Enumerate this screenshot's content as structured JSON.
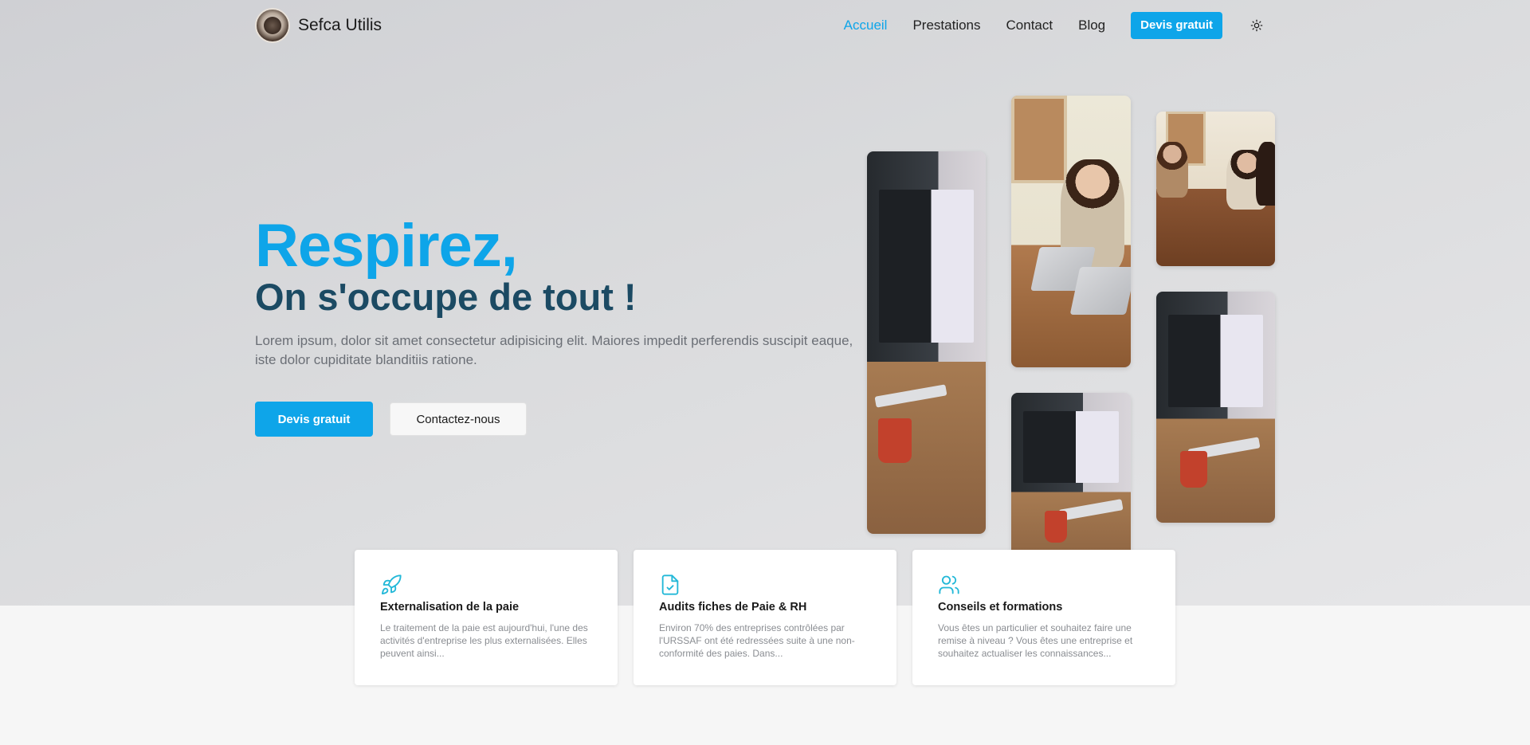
{
  "brand": {
    "name": "Sefca Utilis",
    "logo_icon": "clover-logo-icon"
  },
  "nav": {
    "items": [
      {
        "label": "Accueil",
        "active": true
      },
      {
        "label": "Prestations",
        "active": false
      },
      {
        "label": "Contact",
        "active": false
      },
      {
        "label": "Blog",
        "active": false
      }
    ],
    "cta_label": "Devis gratuit",
    "theme_icon": "sun-icon"
  },
  "hero": {
    "title": "Respirez,",
    "subtitle": "On s'occupe de tout !",
    "description": "Lorem ipsum, dolor sit amet consectetur adipisicing elit. Maiores impedit perferendis suscipit eaque, iste dolor cupiditate blanditiis ratione.",
    "primary_button": "Devis gratuit",
    "secondary_button": "Contactez-nous"
  },
  "services": [
    {
      "icon": "rocket-icon",
      "title": "Externalisation de la paie",
      "text": "Le traitement de la paie est aujourd'hui, l'une des activités d'entreprise les plus externalisées. Elles peuvent ainsi..."
    },
    {
      "icon": "file-check-icon",
      "title": "Audits fiches de Paie & RH",
      "text": "Environ 70% des entreprises contrôlées par l'URSSAF ont été redressées suite à une non-conformité des paies. Dans..."
    },
    {
      "icon": "users-icon",
      "title": "Conseils et formations",
      "text": "Vous êtes un particulier et souhaitez faire une remise à niveau ? Vous êtes une entreprise et souhaitez actualiser les connaissances..."
    }
  ],
  "colors": {
    "accent": "#0ea5e9",
    "heading_dark": "#1b4a63",
    "text_muted": "#6b6f76",
    "hero_bg": "#d6d7da"
  }
}
